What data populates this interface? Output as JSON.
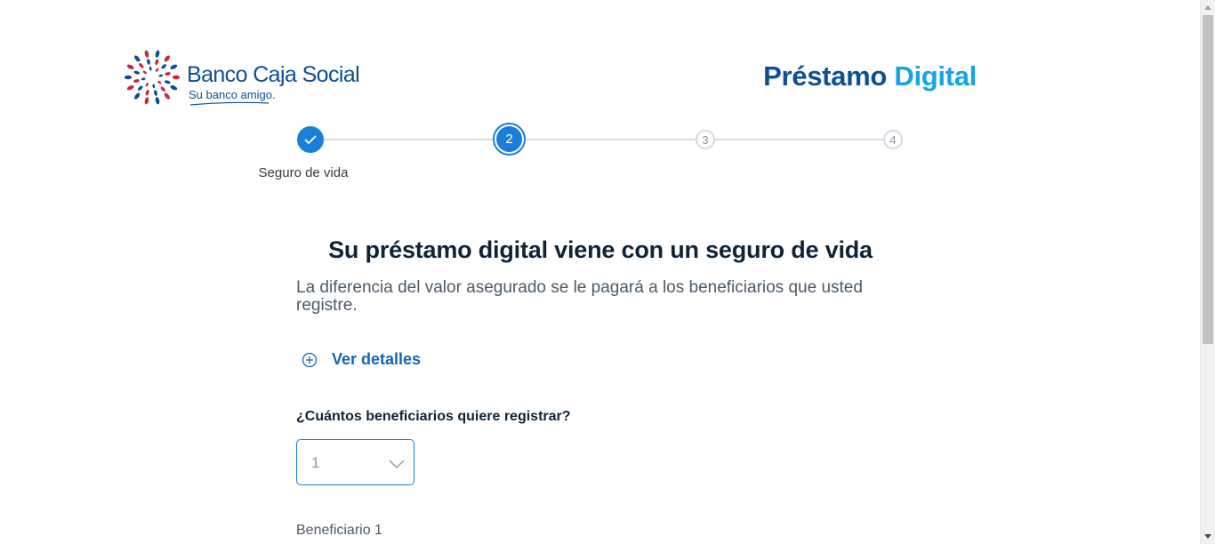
{
  "header": {
    "bank_name": "Banco Caja Social",
    "bank_tagline": "Su banco amigo.",
    "product_title_part1": "Préstamo",
    "product_title_part2": "Digital",
    "colors": {
      "brand_dark": "#0d4f94",
      "brand_light": "#14a5e9",
      "logo_red": "#c8283c"
    }
  },
  "stepper": {
    "steps": [
      {
        "number": "1",
        "state": "completed",
        "icon": "check-icon"
      },
      {
        "number": "2",
        "state": "current"
      },
      {
        "number": "3",
        "state": "pending"
      },
      {
        "number": "4",
        "state": "pending"
      }
    ],
    "current_label": "Seguro de vida"
  },
  "main": {
    "title": "Su préstamo digital viene con un seguro de vida",
    "subtitle": "La diferencia del valor asegurado se le pagará a los beneficiarios que usted registre.",
    "details_link": {
      "label": "Ver detalles",
      "icon": "plus-circle-icon"
    },
    "beneficiaries_question": "¿Cuántos beneficiarios quiere registrar?",
    "beneficiaries_select": {
      "value": "1",
      "icon": "chevron-down-icon"
    },
    "beneficiary_section_label": "Beneficiario 1"
  }
}
